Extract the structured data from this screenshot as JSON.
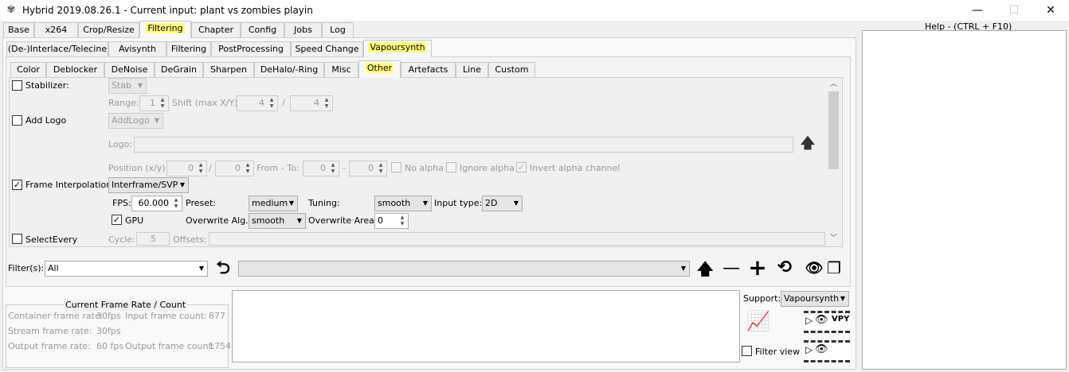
{
  "window": {
    "title": "Hybrid 2019.08.26.1 - Current input: plant vs zombies playin",
    "minimize": "—",
    "maximize": "☐",
    "close": "✕"
  },
  "main_tabs": [
    "Base",
    "x264",
    "Crop/Resize",
    "Filtering",
    "Chapter",
    "Config",
    "Jobs",
    "Log"
  ],
  "filter_tabs": [
    "(De-)Interlace/Telecine",
    "Avisynth",
    "Filtering",
    "PostProcessing",
    "Speed Change",
    "Vapoursynth"
  ],
  "vs_tabs": [
    "Color",
    "Deblocker",
    "DeNoise",
    "DeGrain",
    "Sharpen",
    "DeHalo/-Ring",
    "Misc",
    "Other",
    "Artefacts",
    "Line",
    "Custom"
  ],
  "other": {
    "stabilizer": {
      "label": "Stabilizer:",
      "checked": false,
      "mode": "Stab",
      "range_label": "Range:",
      "range": "1",
      "shift_label": "Shift (max X/Y):",
      "shift_x": "4",
      "sep": "/",
      "shift_y": "4"
    },
    "add_logo": {
      "label": "Add Logo",
      "checked": false,
      "mode": "AddLogo",
      "logo_label": "Logo:",
      "position_label": "Position (x/y):",
      "pos_x": "0",
      "sep": "/",
      "pos_y": "0",
      "from_to_label": "From - To:",
      "from": "0",
      "dash": "-",
      "to": "0",
      "no_alpha": "No alpha",
      "ignore_alpha": "Ignore alpha",
      "invert_alpha": "Invert alpha channel"
    },
    "frame_interpolation": {
      "label": "Frame Interpolation",
      "checked": true,
      "method": "Interframe/SVP",
      "fps_label": "FPS:",
      "fps": "60.000",
      "preset_label": "Preset:",
      "preset": "medium",
      "tuning_label": "Tuning:",
      "tuning": "smooth",
      "input_type_label": "Input type:",
      "input_type": "2D",
      "gpu_label": "GPU",
      "gpu_checked": true,
      "overwrite_alg_label": "Overwrite Alg.:",
      "overwrite_alg": "smooth",
      "overwrite_area_label": "Overwrite Area:",
      "overwrite_area": "0"
    },
    "select_every": {
      "label": "SelectEvery",
      "checked": false,
      "cycle_label": "Cycle:",
      "cycle": "5",
      "offsets_label": "Offsets:"
    }
  },
  "filters": {
    "label": "Filter(s):",
    "selected": "All"
  },
  "frame_rate": {
    "title": "Current Frame Rate / Count",
    "container_label": "Container frame rate:",
    "container_value": "30fps",
    "input_count_label": "Input frame count:",
    "input_count": "877",
    "stream_label": "Stream frame rate:",
    "stream_value": "30fps",
    "output_label": "Output frame rate:",
    "output_value": "60 fps",
    "output_count_label": "Output frame count:",
    "output_count": "1754"
  },
  "support": {
    "label": "Support:",
    "value": "Vapoursynth",
    "filter_view": "Filter view",
    "vpy": "VPY"
  },
  "help": {
    "title": "Help - (CTRL + F10)"
  }
}
